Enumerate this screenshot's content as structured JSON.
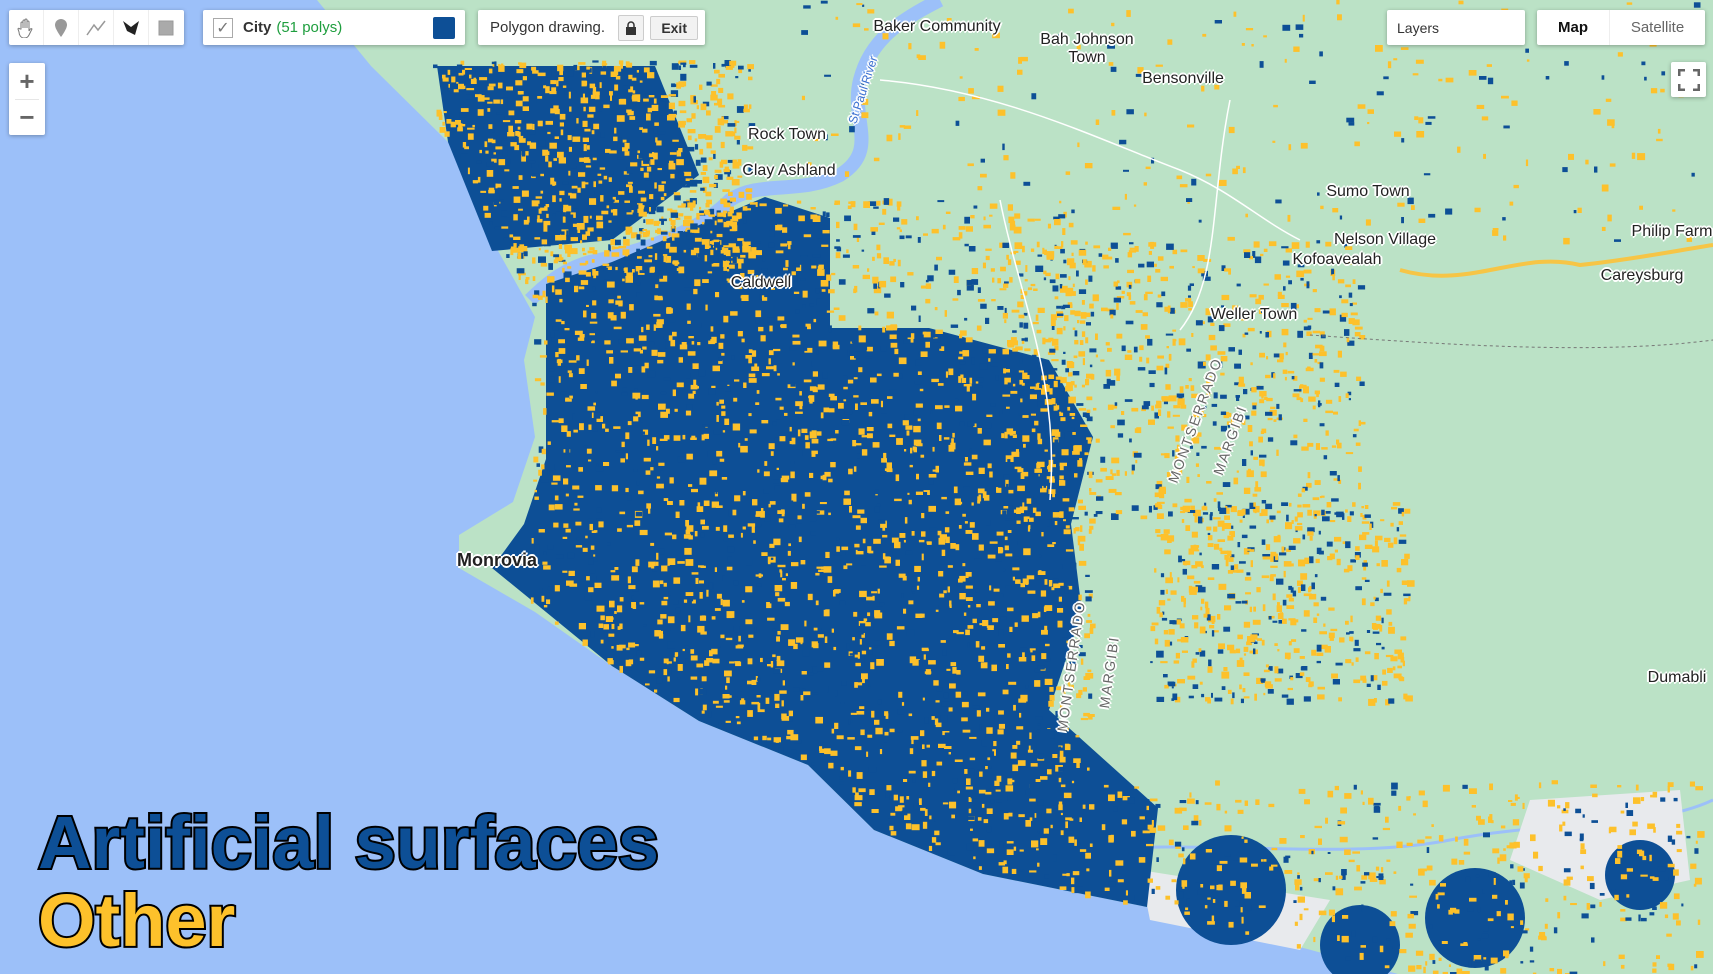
{
  "colors": {
    "ocean": "#9cc0f9",
    "land": "#bbe2c6",
    "artificial": "#0d4f96",
    "other": "#fdc12b",
    "urban": "#e8eaed",
    "river": "#9cc0f9",
    "layer_green": "#1e9e3e"
  },
  "drawing_tools": [
    {
      "icon": "hand-icon"
    },
    {
      "icon": "marker-icon"
    },
    {
      "icon": "line-icon"
    },
    {
      "icon": "polygon-icon"
    },
    {
      "icon": "rectangle-icon"
    }
  ],
  "layer_panel": {
    "checked": true,
    "name": "City",
    "count": "(51 polys)",
    "swatch_color": "#0d4f96"
  },
  "drawing_panel": {
    "status": "Polygon drawing.",
    "lock_icon": "lock-icon",
    "exit_label": "Exit"
  },
  "zoom": {
    "in": "+",
    "out": "−"
  },
  "layers_button": "Layers",
  "map_type": {
    "options": [
      "Map",
      "Satellite"
    ],
    "selected": "Map"
  },
  "fullscreen_icon": "fullscreen-icon",
  "places": [
    "Baker Community",
    "Bah Johnson Town",
    "Bensonville",
    "Rock Town",
    "Clay Ashland",
    "Sumo Town",
    "Nelson Village",
    "Kofoavealah",
    "Philip Farm",
    "Careysburg",
    "Weller Town",
    "Dumabli",
    "Caldwell",
    "Monrovia",
    "St Paul River",
    "MONTSERRADO",
    "MARGIBI"
  ],
  "legend": {
    "artificial": "Artificial surfaces",
    "other": "Other"
  }
}
